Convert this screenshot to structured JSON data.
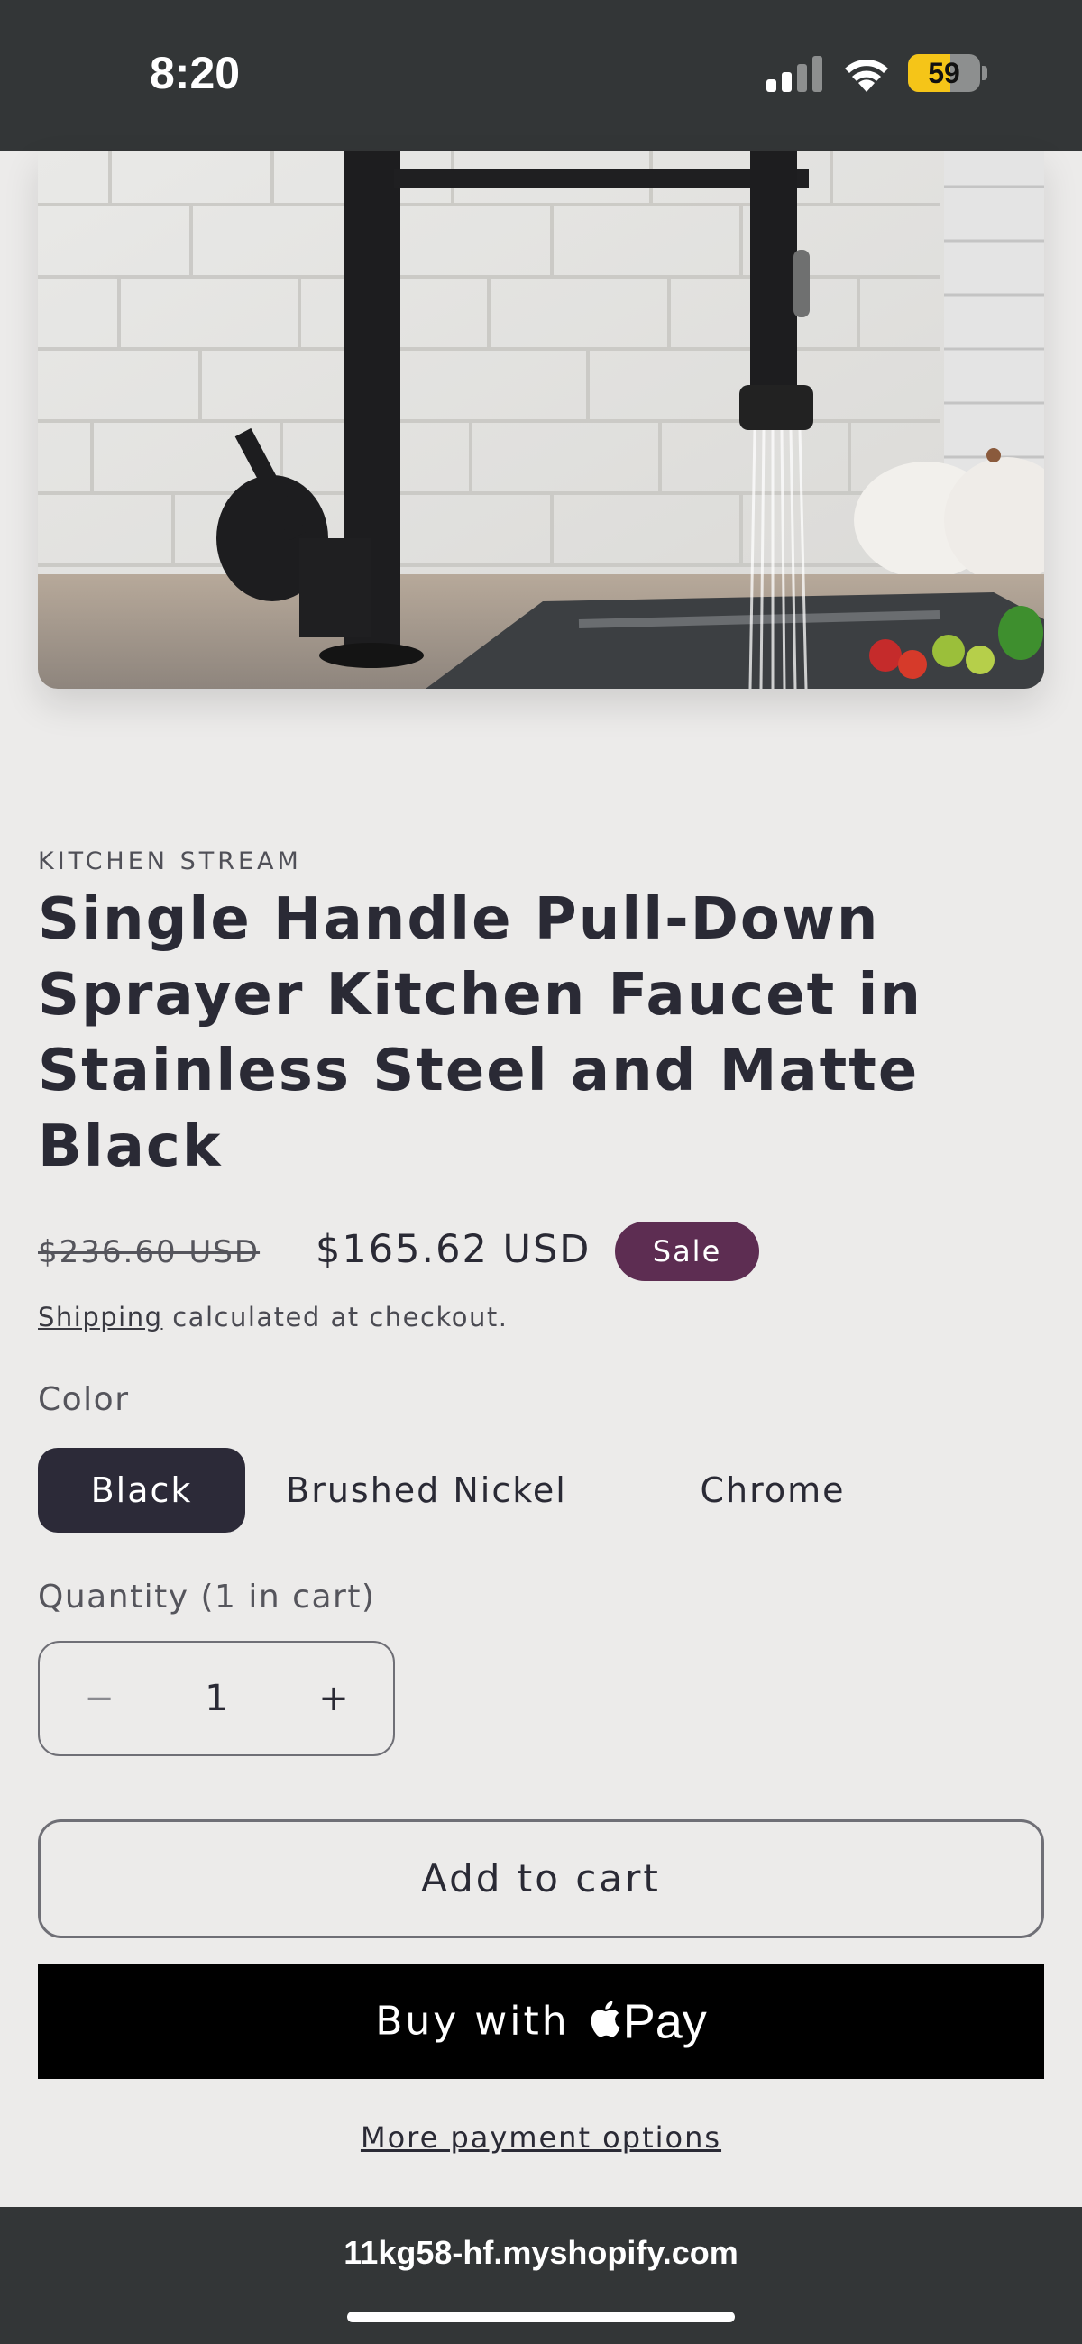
{
  "status_bar": {
    "time": "8:20",
    "battery_level": "59",
    "battery_fraction": 0.59,
    "signal_icon": "cellular-signal-icon",
    "wifi_icon": "wifi-icon"
  },
  "product": {
    "image_alt": "black-pull-down-kitchen-faucet-photo",
    "vendor": "KITCHEN STREAM",
    "title": "Single Handle Pull-Down Sprayer Kitchen Faucet in Stainless Steel and Matte Black",
    "price_regular": "$236.60 USD",
    "price_sale": "$165.62 USD",
    "badge": "Sale",
    "shipping_link": "Shipping",
    "shipping_text": " calculated at checkout."
  },
  "color": {
    "label": "Color",
    "options": [
      "Black",
      "Brushed Nickel",
      "Chrome"
    ],
    "selected": "Black"
  },
  "quantity": {
    "label": "Quantity (1 in cart)",
    "value": "1",
    "minus_symbol": "−",
    "plus_symbol": "+"
  },
  "actions": {
    "add_to_cart": "Add to cart",
    "buy_with": "Buy with",
    "pay_label": "Pay",
    "more_payment": "More payment options"
  },
  "browser": {
    "url": "11kg58-hf.myshopify.com"
  },
  "colors": {
    "background": "#ecebea",
    "sale_badge": "#5d2d52",
    "selected_pill": "#2c2a38",
    "status_bar": "#333637"
  }
}
